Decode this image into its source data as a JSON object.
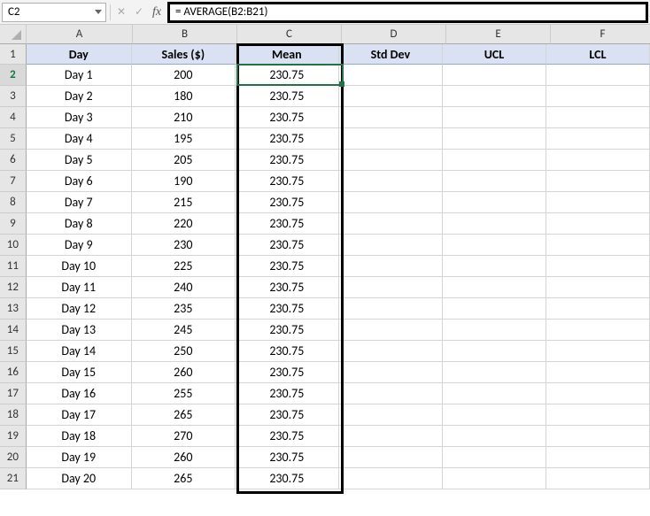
{
  "formulaBar": {
    "nameBox": "C2",
    "formula": "= AVERAGE(B2:B21)"
  },
  "columns": [
    "A",
    "B",
    "C",
    "D",
    "E",
    "F"
  ],
  "headerRow": {
    "rowNum": "1",
    "cells": [
      "Day",
      "Sales ($)",
      "Mean",
      "Std Dev",
      "UCL",
      "LCL"
    ]
  },
  "rows": [
    {
      "n": "2",
      "day": "Day 1",
      "sales": "200",
      "mean": "230.75"
    },
    {
      "n": "3",
      "day": "Day 2",
      "sales": "180",
      "mean": "230.75"
    },
    {
      "n": "4",
      "day": "Day 3",
      "sales": "210",
      "mean": "230.75"
    },
    {
      "n": "5",
      "day": "Day 4",
      "sales": "195",
      "mean": "230.75"
    },
    {
      "n": "6",
      "day": "Day 5",
      "sales": "205",
      "mean": "230.75"
    },
    {
      "n": "7",
      "day": "Day 6",
      "sales": "190",
      "mean": "230.75"
    },
    {
      "n": "8",
      "day": "Day 7",
      "sales": "215",
      "mean": "230.75"
    },
    {
      "n": "9",
      "day": "Day 8",
      "sales": "220",
      "mean": "230.75"
    },
    {
      "n": "10",
      "day": "Day 9",
      "sales": "230",
      "mean": "230.75"
    },
    {
      "n": "11",
      "day": "Day 10",
      "sales": "225",
      "mean": "230.75"
    },
    {
      "n": "12",
      "day": "Day 11",
      "sales": "240",
      "mean": "230.75"
    },
    {
      "n": "13",
      "day": "Day 12",
      "sales": "235",
      "mean": "230.75"
    },
    {
      "n": "14",
      "day": "Day 13",
      "sales": "245",
      "mean": "230.75"
    },
    {
      "n": "15",
      "day": "Day 14",
      "sales": "250",
      "mean": "230.75"
    },
    {
      "n": "16",
      "day": "Day 15",
      "sales": "260",
      "mean": "230.75"
    },
    {
      "n": "17",
      "day": "Day 16",
      "sales": "255",
      "mean": "230.75"
    },
    {
      "n": "18",
      "day": "Day 17",
      "sales": "265",
      "mean": "230.75"
    },
    {
      "n": "19",
      "day": "Day 18",
      "sales": "270",
      "mean": "230.75"
    },
    {
      "n": "20",
      "day": "Day 19",
      "sales": "260",
      "mean": "230.75"
    },
    {
      "n": "21",
      "day": "Day 20",
      "sales": "265",
      "mean": "230.75"
    }
  ]
}
